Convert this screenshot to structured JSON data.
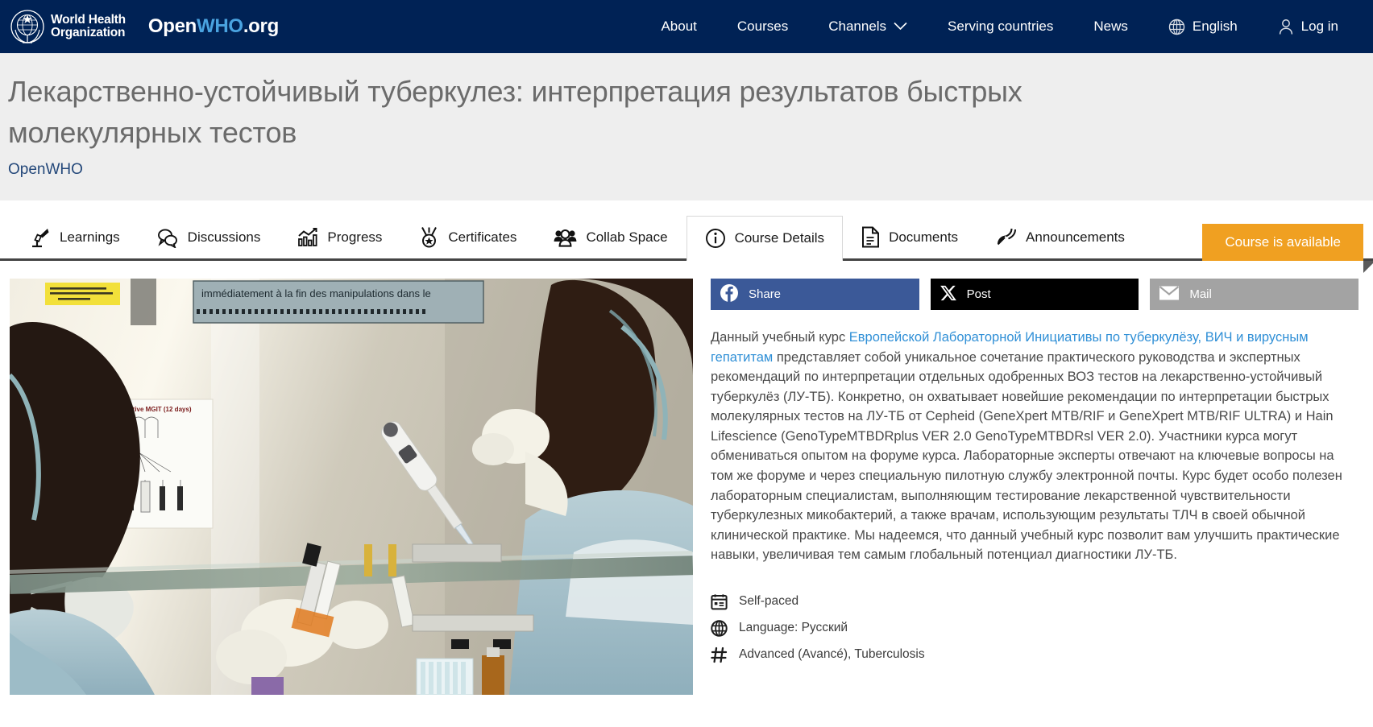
{
  "topnav": {
    "who_line1": "World Health",
    "who_line2": "Organization",
    "brand_open": "Open",
    "brand_who": "WHO",
    "brand_org": ".org",
    "links": [
      {
        "label": "About",
        "name": "nav-about",
        "has_chevron": false
      },
      {
        "label": "Courses",
        "name": "nav-courses",
        "has_chevron": false
      },
      {
        "label": "Channels",
        "name": "nav-channels",
        "has_chevron": true
      },
      {
        "label": "Serving countries",
        "name": "nav-serving-countries",
        "has_chevron": false
      },
      {
        "label": "News",
        "name": "nav-news",
        "has_chevron": false
      }
    ],
    "language": "English",
    "login": "Log in",
    "bg_color": "#002255",
    "accent_color": "#4aa3e0"
  },
  "header": {
    "title": "Лекарственно-устойчивый туберкулез: интерпретация результатов быстрых молекулярных тестов",
    "provider": "OpenWHO",
    "badge": "Course is available",
    "badge_color": "#f0a021"
  },
  "tabs": [
    {
      "label": "Learnings",
      "name": "tab-learnings",
      "icon": "learnings-icon",
      "active": false
    },
    {
      "label": "Discussions",
      "name": "tab-discussions",
      "icon": "discussions-icon",
      "active": false
    },
    {
      "label": "Progress",
      "name": "tab-progress",
      "icon": "progress-icon",
      "active": false
    },
    {
      "label": "Certificates",
      "name": "tab-certificates",
      "icon": "certificate-icon",
      "active": false
    },
    {
      "label": "Collab Space",
      "name": "tab-collab-space",
      "icon": "people-icon",
      "active": false
    },
    {
      "label": "Course Details",
      "name": "tab-course-details",
      "icon": "info-icon",
      "active": true
    },
    {
      "label": "Documents",
      "name": "tab-documents",
      "icon": "document-icon",
      "active": false
    },
    {
      "label": "Announcements",
      "name": "tab-announcements",
      "icon": "megaphone-icon",
      "active": false
    }
  ],
  "share": {
    "facebook": "Share",
    "x": "Post",
    "mail": "Mail",
    "facebook_color": "#3b5998",
    "x_color": "#000000",
    "mail_color": "#a3a3a3"
  },
  "description": {
    "part1": "Данный учебный курс ",
    "link": "Европейской Лабораторной Инициативы по туберкулёзу, ВИЧ и вирусным гепатитам",
    "part2": " представляет собой уникальное сочетание практического руководства и экспертных рекомендаций по интерпретации отдельных одобренных ВОЗ тестов на лекарственно-устойчивый туберкулёз (ЛУ-ТБ). Конкретно, он охватывает новейшие рекомендации по интерпретации быстрых молекулярных тестов на ЛУ-ТБ от Cepheid (GeneXpert MTB/RIF и GeneXpert MTB/RIF ULTRA) и Hain Lifescience (GenoTypeMTBDRplus VER 2.0 GenoTypeMTBDRsl VER 2.0). Участники курса могут обмениваться опытом на форуме курса. Лабораторные эксперты отвечают на ключевые вопросы на том же форуме и через специальную пилотную службу электронной почты. Курс будет особо полезен лабораторным специалистам, выполняющим тестирование лекарственной чувствительности туберкулезных микобактерий, а также врачам, использующим результаты ТЛЧ в своей обычной клинической практике. Мы надеемся, что данный учебный курс позволит вам улучшить практические навыки, увеличивая тем самым глобальный потенциал диагностики ЛУ-ТБ."
  },
  "meta": [
    {
      "label": "Self-paced",
      "icon": "calendar-icon",
      "name": "meta-pace"
    },
    {
      "label": "Language: Русский",
      "icon": "globe-icon",
      "name": "meta-language"
    },
    {
      "label": "Advanced (Avancé), Tuberculosis",
      "icon": "hash-icon",
      "name": "meta-tags"
    }
  ],
  "course_image": {
    "caption_sign": "immédiatement à la fin des manipulations dans le",
    "chart_label": "...tive MGIT (12 days)",
    "alt": "Two laboratory workers in masks and gloves handling specimen tubes with a pipette inside a biosafety cabinet"
  }
}
